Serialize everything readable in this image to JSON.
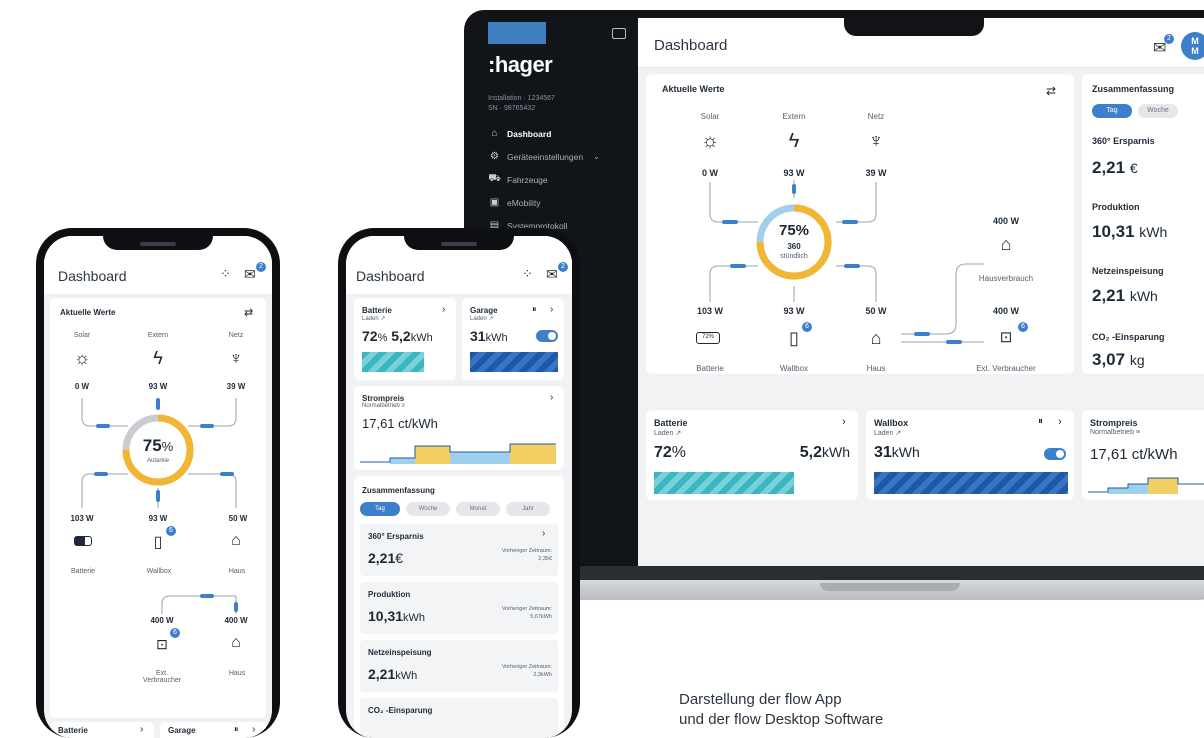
{
  "caption": {
    "line1": "Darstellung der flow App",
    "line2": "und der flow Desktop Software"
  },
  "desktop": {
    "logo": ":hager",
    "installation_line1": "Installation · 1234567",
    "installation_line2": "SN · 98765432",
    "nav": [
      {
        "label": "Dashboard",
        "icon": "home-icon",
        "glyph": "⌂"
      },
      {
        "label": "Geräteeinstellungen",
        "icon": "settings-nodes-icon",
        "glyph": "⚙"
      },
      {
        "label": "Fahrzeuge",
        "icon": "car-icon",
        "glyph": "⛟"
      },
      {
        "label": "eMobility",
        "icon": "charger-icon",
        "glyph": "▣"
      },
      {
        "label": "Systemprotokoll",
        "icon": "log-icon",
        "glyph": "▤"
      }
    ],
    "page_title": "Dashboard",
    "mail_badge": "2",
    "avatar": "M\nM",
    "aktuelle_werte": {
      "title": "Aktuelle Werte",
      "sources": [
        {
          "label": "Solar",
          "value": "0 W",
          "icon": "sun-icon"
        },
        {
          "label": "Extern",
          "value": "93 W",
          "icon": "lightning-icon"
        },
        {
          "label": "Netz",
          "value": "39 W",
          "icon": "power-tower-icon"
        }
      ],
      "ring_percent": "75%",
      "ring_sub1": "360",
      "ring_sub2": "stündlich",
      "consumers": [
        {
          "label": "Batterie",
          "value": "103 W",
          "icon": "battery-icon",
          "badge": "72%"
        },
        {
          "label": "Wallbox",
          "value": "93 W",
          "icon": "wallbox-icon",
          "badge": "6"
        },
        {
          "label": "Haus",
          "value": "50 W",
          "icon": "house-chart-icon"
        }
      ],
      "right": [
        {
          "label": "Hausverbrauch",
          "value": "400 W",
          "icon": "house-icon"
        },
        {
          "label": "Ext. Verbraucher",
          "value": "400 W",
          "icon": "ext-consumer-icon",
          "badge": "6"
        }
      ],
      "ring_progress": 0.75
    },
    "zusammenfassung": {
      "title": "Zusammenfassung",
      "tabs": [
        "Tag",
        "Woche"
      ],
      "items": [
        {
          "label": "360° Ersparnis",
          "value": "2,21",
          "unit": "€"
        },
        {
          "label": "Produktion",
          "value": "10,31",
          "unit": "kWh"
        },
        {
          "label": "Netzeinspeisung",
          "value": "2,21",
          "unit": "kWh"
        },
        {
          "label": "CO₂ -Einsparung",
          "value": "3,07",
          "unit": "kg"
        }
      ]
    },
    "batterie": {
      "title": "Batterie",
      "sub": "Laden ↗",
      "percent": "72",
      "pct_sign": "%",
      "energy": "5,2",
      "energy_unit": "kWh"
    },
    "wallbox": {
      "title": "Wallbox",
      "sub": "Laden ↗",
      "energy": "31",
      "energy_unit": "kWh"
    },
    "strompreis": {
      "title": "Strompreis",
      "sub": "Normalbetrieb ≡",
      "value": "17,61 ct/kWh"
    }
  },
  "phone_left": {
    "title": "Dashboard",
    "badge": "2",
    "aktuelle_werte": "Aktuelle Werte",
    "sources": [
      {
        "label": "Solar",
        "value": "0 W"
      },
      {
        "label": "Extern",
        "value": "93 W"
      },
      {
        "label": "Netz",
        "value": "39 W"
      }
    ],
    "ring_percent": "75",
    "ring_pct_sign": "%",
    "ring_sub": "Autarkie",
    "consumers": [
      {
        "label": "Batterie",
        "value": "103 W"
      },
      {
        "label": "Wallbox",
        "value": "93 W",
        "badge": "6"
      },
      {
        "label": "Haus",
        "value": "50 W"
      }
    ],
    "bottom": [
      {
        "label": "Ext.\nVerbraucher",
        "value": "400 W",
        "badge": "6"
      },
      {
        "label": "Haus",
        "value": "400 W"
      }
    ],
    "footer_cards": [
      "Batterie",
      "Garage"
    ]
  },
  "phone_right": {
    "title": "Dashboard",
    "badge": "2",
    "batterie": {
      "title": "Batterie",
      "sub": "Laden ↗",
      "percent": "72",
      "pct_sign": "%",
      "energy": "5,2",
      "energy_unit": "kWh"
    },
    "garage": {
      "title": "Garage",
      "sub": "Laden ↗",
      "energy": "31",
      "energy_unit": "kWh"
    },
    "strompreis": {
      "title": "Strompreis",
      "sub": "Normalbetrieb ≡",
      "value": "17,61 ct/kWh"
    },
    "zusammenfassung": {
      "title": "Zusammenfassung",
      "tabs": [
        "Tag",
        "Woche",
        "Monat",
        "Jahr"
      ],
      "prev_label": "Vorheriger Zeitraum:",
      "items": [
        {
          "label": "360° Ersparnis",
          "value": "2,21",
          "unit": "€",
          "prev": "2,35€"
        },
        {
          "label": "Produktion",
          "value": "10,31",
          "unit": "kWh",
          "prev": "5,67kWh"
        },
        {
          "label": "Netzeinspeisung",
          "value": "2,21",
          "unit": "kWh",
          "prev": "2,3kWh"
        },
        {
          "label": "CO₂ -Einsparung",
          "value": "",
          "unit": "",
          "prev": ""
        }
      ]
    }
  },
  "colors": {
    "accent": "#3d7fcb",
    "solar": "#f2b632",
    "ring_blue": "#9fd0ee",
    "teal": "#3cb5c2",
    "navy": "#1f58a8"
  }
}
